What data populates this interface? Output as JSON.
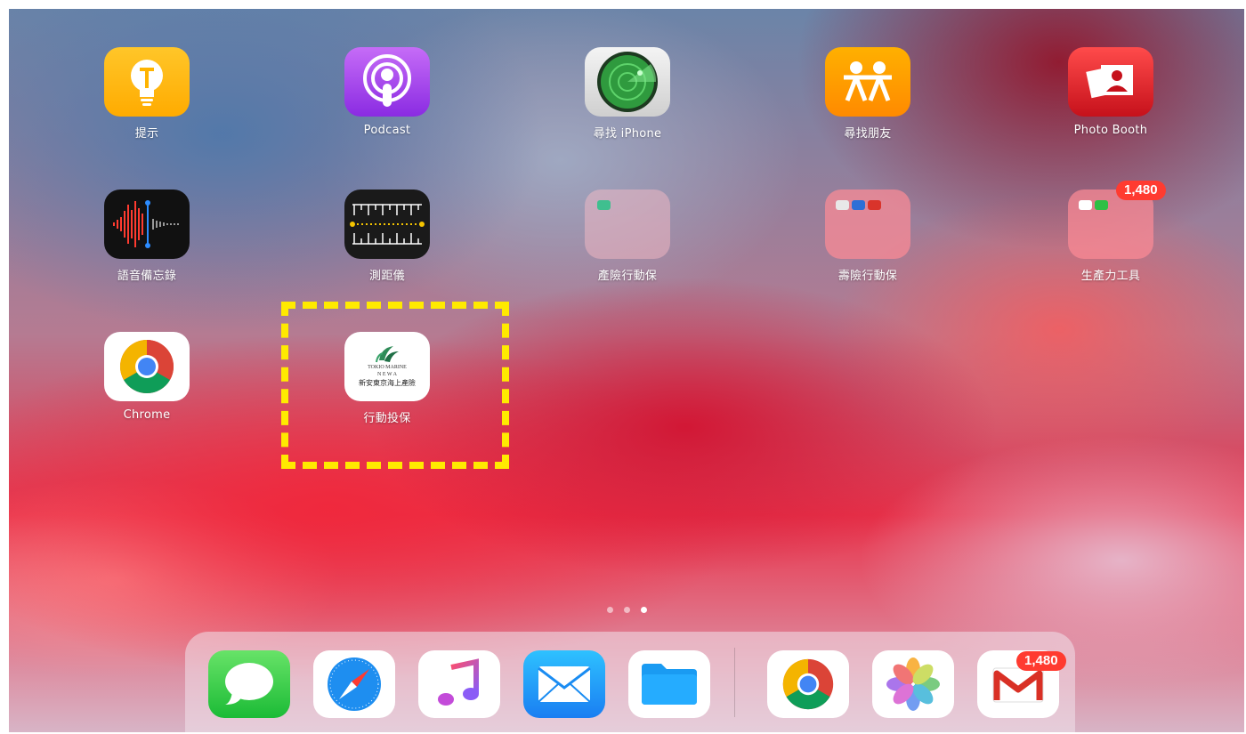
{
  "home": {
    "apps": [
      {
        "label": "提示",
        "icon": "tips-icon"
      },
      {
        "label": "Podcast",
        "icon": "podcast-icon"
      },
      {
        "label": "尋找 iPhone",
        "icon": "find-iphone-icon"
      },
      {
        "label": "尋找朋友",
        "icon": "find-friends-icon"
      },
      {
        "label": "Photo Booth",
        "icon": "photo-booth-icon"
      },
      {
        "label": "語音備忘錄",
        "icon": "voice-memos-icon"
      },
      {
        "label": "測距儀",
        "icon": "measure-icon"
      },
      {
        "label": "產險行動保",
        "icon": "folder-icon"
      },
      {
        "label": "壽險行動保",
        "icon": "folder-icon"
      },
      {
        "label": "生產力工具",
        "icon": "folder-icon",
        "badge": "1,480"
      },
      {
        "label": "Chrome",
        "icon": "chrome-icon"
      },
      {
        "label": "行動投保",
        "icon": "tokio-marine-icon"
      }
    ],
    "tokio": {
      "line1": "TOKIO MARINE",
      "line2": "N E W A",
      "line3": "新安東京海上產險"
    },
    "highlight_color": "#ffea00",
    "page_dots": {
      "count": 3,
      "current": 3
    }
  },
  "dock": {
    "apps": [
      {
        "name": "Messages",
        "icon": "messages-icon"
      },
      {
        "name": "Safari",
        "icon": "safari-icon"
      },
      {
        "name": "Music",
        "icon": "music-icon"
      },
      {
        "name": "Mail",
        "icon": "mail-icon"
      },
      {
        "name": "Files",
        "icon": "files-icon"
      },
      {
        "name": "Chrome",
        "icon": "chrome-icon"
      },
      {
        "name": "Photos",
        "icon": "photos-icon"
      },
      {
        "name": "Gmail",
        "icon": "gmail-icon",
        "badge": "1,480"
      }
    ]
  }
}
